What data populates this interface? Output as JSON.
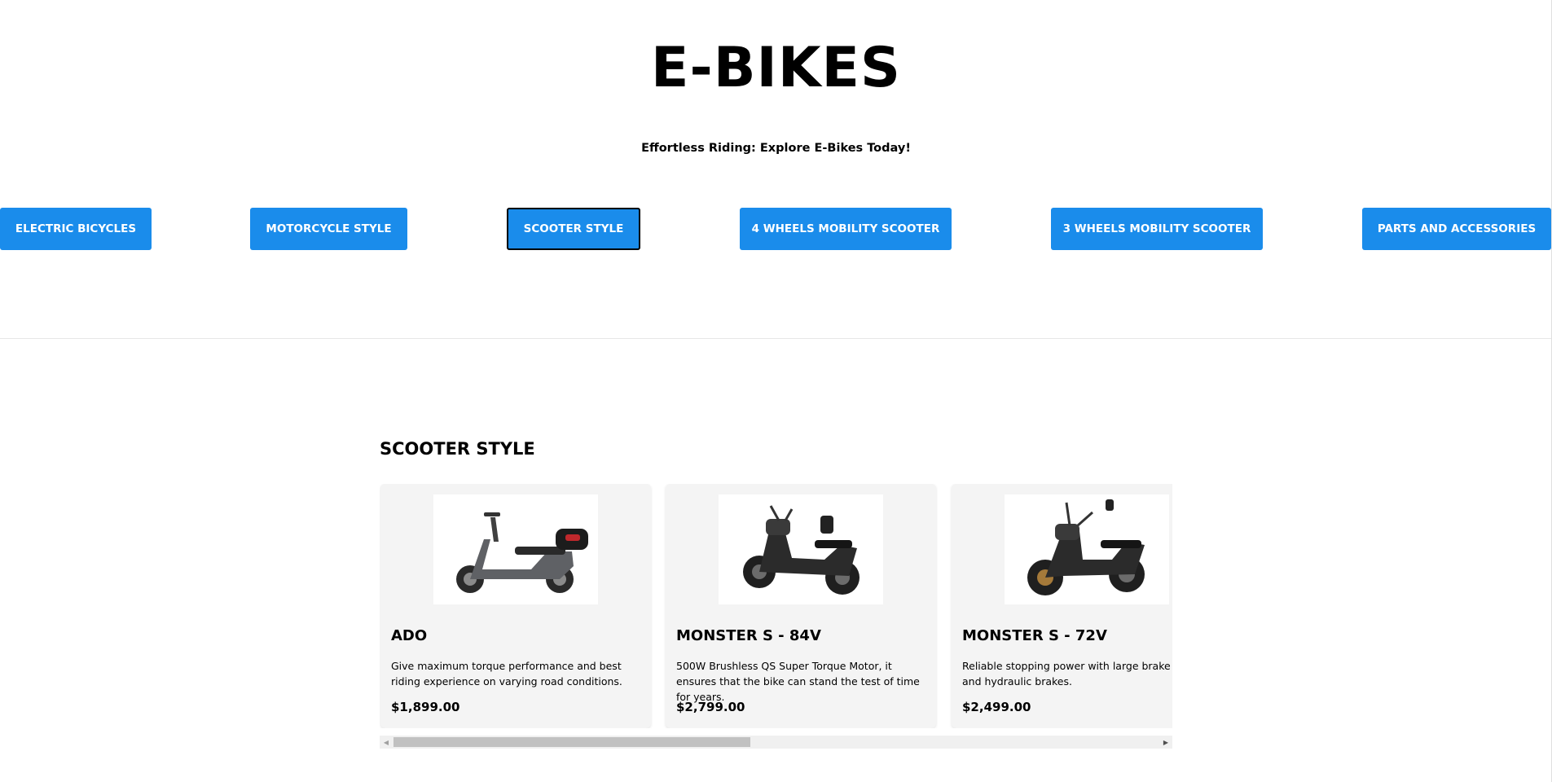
{
  "hero": {
    "title": "E-BIKES",
    "subtitle": "Effortless Riding: Explore E-Bikes Today!"
  },
  "categories": [
    {
      "label": "ELECTRIC BICYCLES",
      "active": false
    },
    {
      "label": "MOTORCYCLE STYLE",
      "active": false
    },
    {
      "label": "SCOOTER STYLE",
      "active": true
    },
    {
      "label": "4 WHEELS MOBILITY SCOOTER",
      "active": false
    },
    {
      "label": "3 WHEELS MOBILITY SCOOTER",
      "active": false
    },
    {
      "label": "PARTS AND ACCESSORIES",
      "active": false
    }
  ],
  "section": {
    "title": "SCOOTER STYLE"
  },
  "products": [
    {
      "name": "ADO",
      "description": "Give maximum torque performance and best riding experience on varying road conditions.",
      "price": "$1,899.00",
      "image_icon": "scooter-image-ado"
    },
    {
      "name": "MONSTER S - 84V",
      "description": "500W Brushless QS Super Torque Motor, it ensures that the bike can stand the test of time for years.",
      "price": "$2,799.00",
      "image_icon": "scooter-image-monster-s-84v"
    },
    {
      "name": "MONSTER S - 72V",
      "description": "Reliable stopping power with large brake discs and hydraulic brakes.",
      "price": "$2,499.00",
      "image_icon": "scooter-image-monster-s-72v"
    }
  ],
  "scrollbar": {
    "left_arrow_icon": "arrow-left-icon",
    "right_arrow_icon": "arrow-right-icon"
  },
  "colors": {
    "button_blue": "#1a8ceb",
    "card_bg": "#f4f4f4"
  }
}
